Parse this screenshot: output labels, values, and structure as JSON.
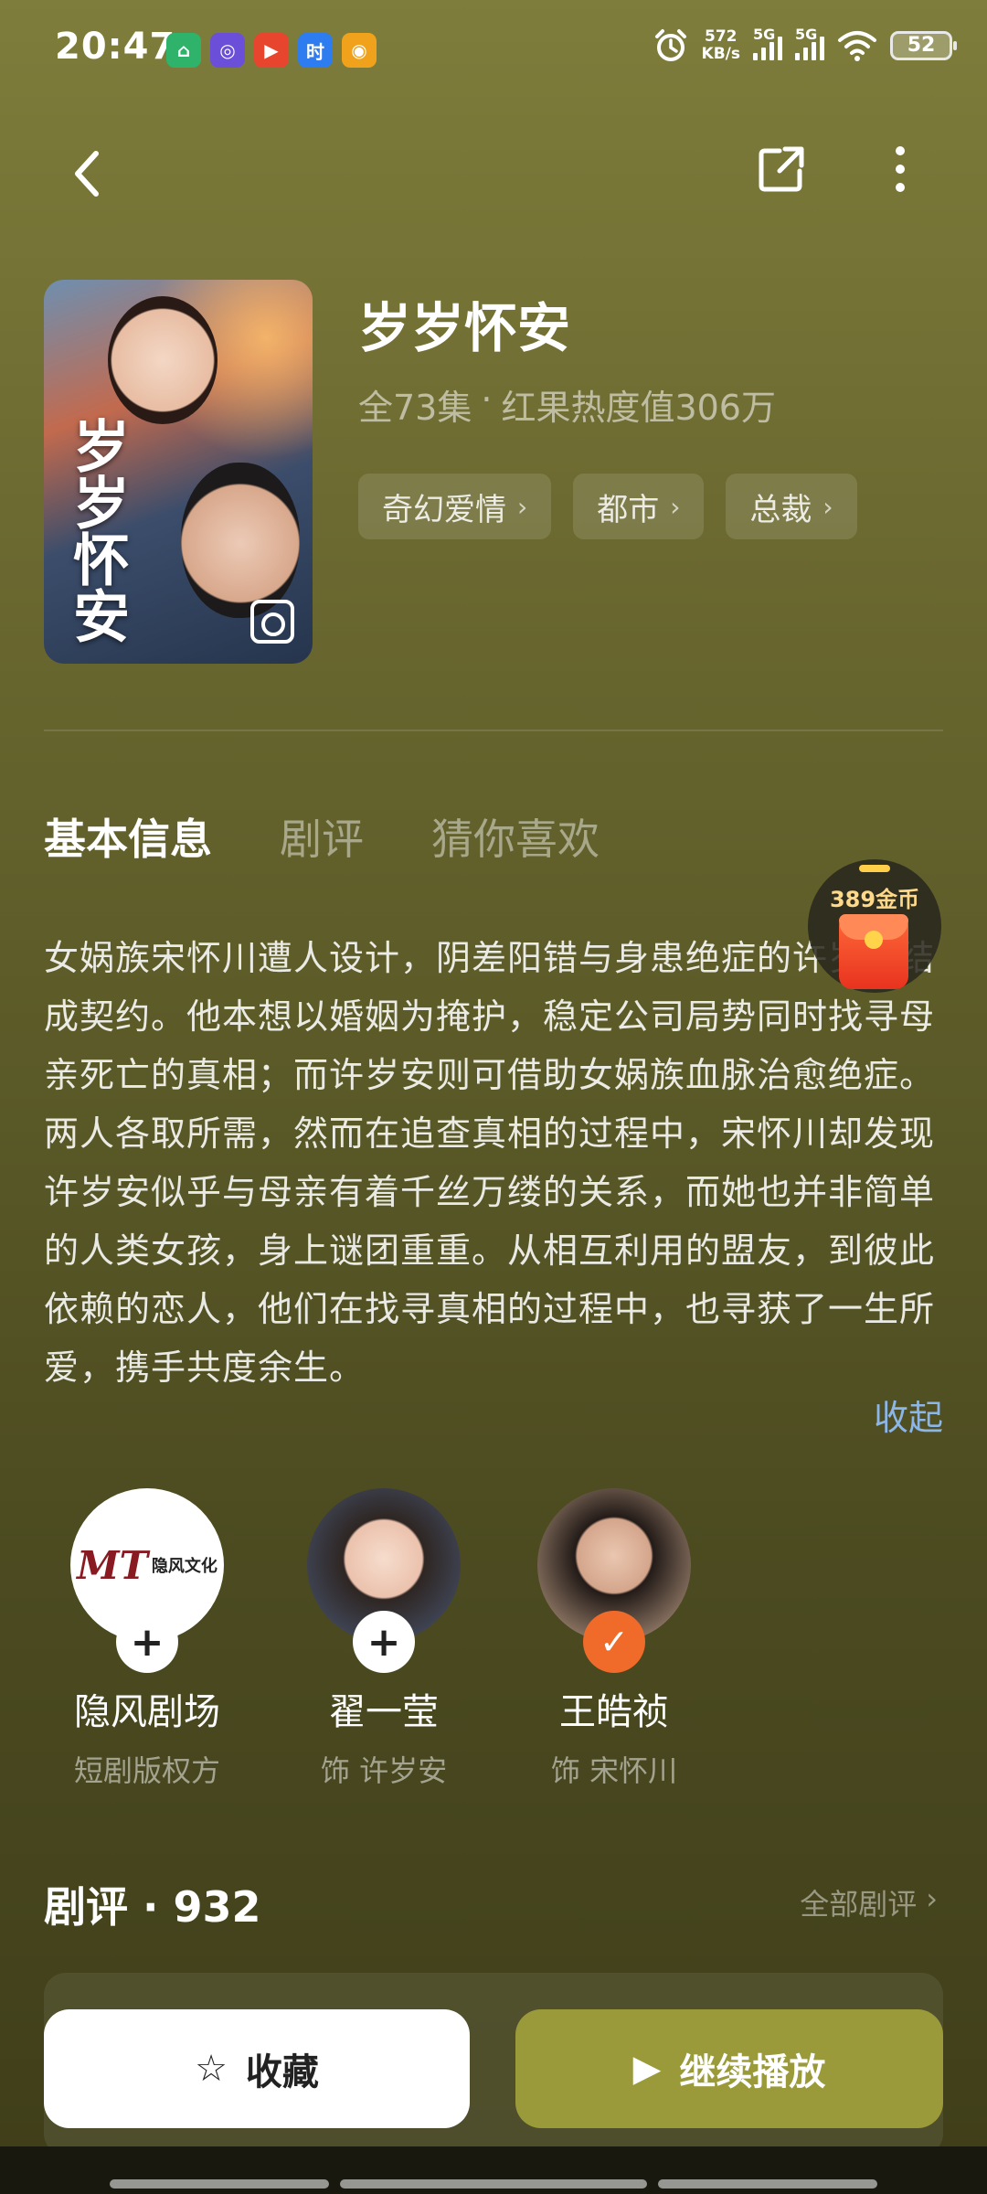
{
  "status": {
    "time": "20:47",
    "app_icons": [
      {
        "name": "home-app-icon",
        "glyph": "⌂",
        "color": "#2fb36b"
      },
      {
        "name": "camera-app-icon",
        "glyph": "◎",
        "color": "#6b4fd8"
      },
      {
        "name": "store-app-icon",
        "glyph": "▶",
        "color": "#e8452e"
      },
      {
        "name": "shi-app-icon",
        "glyph": "时",
        "color": "#2d7cf0"
      },
      {
        "name": "weibo-app-icon",
        "glyph": "◉",
        "color": "#f0a21c"
      }
    ],
    "net_speed_value": "572",
    "net_speed_unit": "KB/s",
    "signal1": "5G",
    "signal2": "5G",
    "battery": "52"
  },
  "nav": {
    "back_icon": "chevron-left-icon",
    "share_icon": "share-icon",
    "more_icon": "more-vertical-icon"
  },
  "drama": {
    "poster_title": "岁岁怀安",
    "title": "岁岁怀安",
    "episodes": "全73集",
    "separator": "·",
    "heat": "红果热度值306万",
    "tags": [
      "奇幻爱情",
      "都市",
      "总裁"
    ]
  },
  "tabs": [
    "基本信息",
    "剧评",
    "猜你喜欢"
  ],
  "active_tab": "基本信息",
  "description": "女娲族宋怀川遭人设计，阴差阳错与身患绝症的许岁安结成契约。他本想以婚姻为掩护，稳定公司局势同时找寻母亲死亡的真相；而许岁安则可借助女娲族血脉治愈绝症。两人各取所需，然而在追查真相的过程中，宋怀川却发现许岁安似乎与母亲有着千丝万缕的关系，而她也并非简单的人类女孩，身上谜团重重。从相互利用的盟友，到彼此依赖的恋人，他们在找寻真相的过程中，也寻获了一生所爱，携手共度余生。",
  "collapse_label": "收起",
  "coin_badge": "389金币",
  "people": [
    {
      "name": "隐风剧场",
      "role": "短剧版权方",
      "logo_mark": "MT",
      "logo_text": "隐风文化",
      "follow": "+"
    },
    {
      "name": "翟一莹",
      "role": "饰 许岁安",
      "follow": "+"
    },
    {
      "name": "王皓祯",
      "role": "饰 宋怀川",
      "follow": "✓"
    }
  ],
  "reviews": {
    "label": "剧评 · 932",
    "all_label": "全部剧评",
    "chevron": "›"
  },
  "actions": {
    "favorite_label": "收藏",
    "favorite_icon": "☆",
    "play_label": "继续播放",
    "play_icon": "▶"
  },
  "colors": {
    "accent_play": "#9a9a3a",
    "follow_done": "#f06a2a",
    "link": "#8cb6e8"
  }
}
